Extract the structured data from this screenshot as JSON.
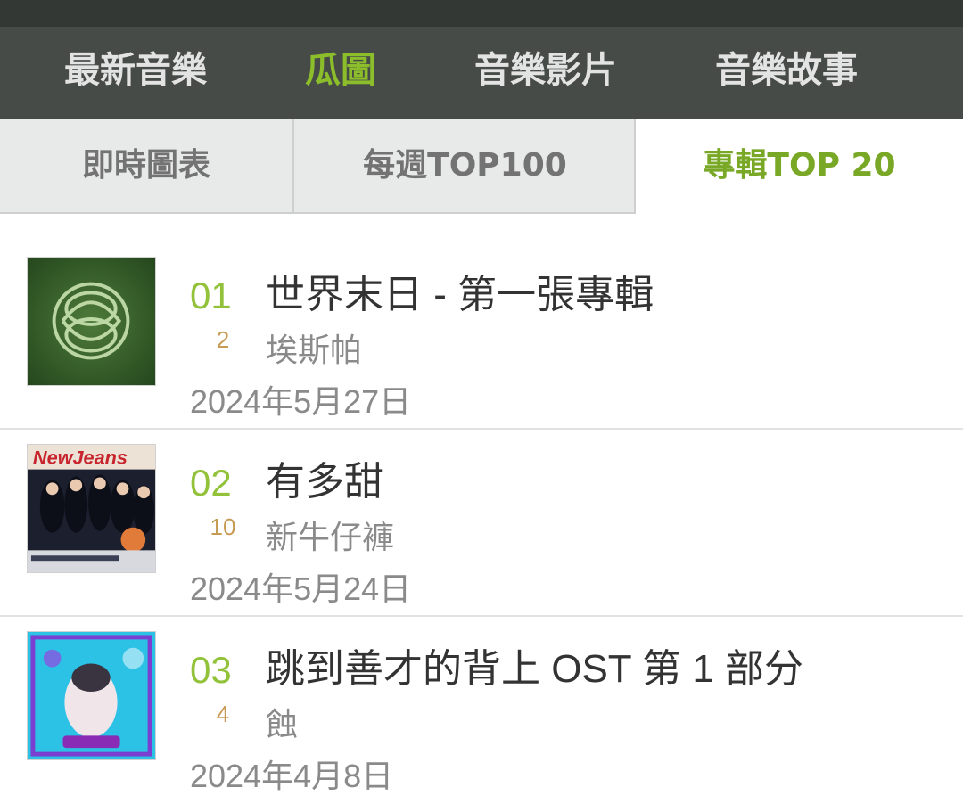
{
  "main_nav": {
    "items": [
      {
        "label": "最新音樂",
        "active": false
      },
      {
        "label": "瓜圖",
        "active": true
      },
      {
        "label": "音樂影片",
        "active": false
      },
      {
        "label": "音樂故事",
        "active": false
      }
    ]
  },
  "sub_tabs": {
    "items": [
      {
        "label": "即時圖表",
        "active": false
      },
      {
        "label": "每週TOP100",
        "active": false
      },
      {
        "label": "專輯TOP 20",
        "active": true
      }
    ]
  },
  "albums": [
    {
      "rank": "01",
      "prev_rank": "2",
      "title": "世界末日 - 第一張專輯",
      "artist": "埃斯帕",
      "date": "2024年5月27日",
      "cover_icon": "green-album-cover"
    },
    {
      "rank": "02",
      "prev_rank": "10",
      "title": "有多甜",
      "artist": "新牛仔褲",
      "date": "2024年5月24日",
      "cover_icon": "newjeans-album-cover",
      "cover_text": "NewJeans"
    },
    {
      "rank": "03",
      "prev_rank": "4",
      "title": "跳到善才的背上 OST 第 1 部分",
      "artist": "蝕",
      "date": "2024年4月8日",
      "cover_icon": "blue-album-cover"
    }
  ],
  "colors": {
    "header_bg": "#464b48",
    "accent_green": "#8cbd2b",
    "prev_rank_gold": "#c69a52",
    "tab_bg": "#e8e9e9"
  }
}
